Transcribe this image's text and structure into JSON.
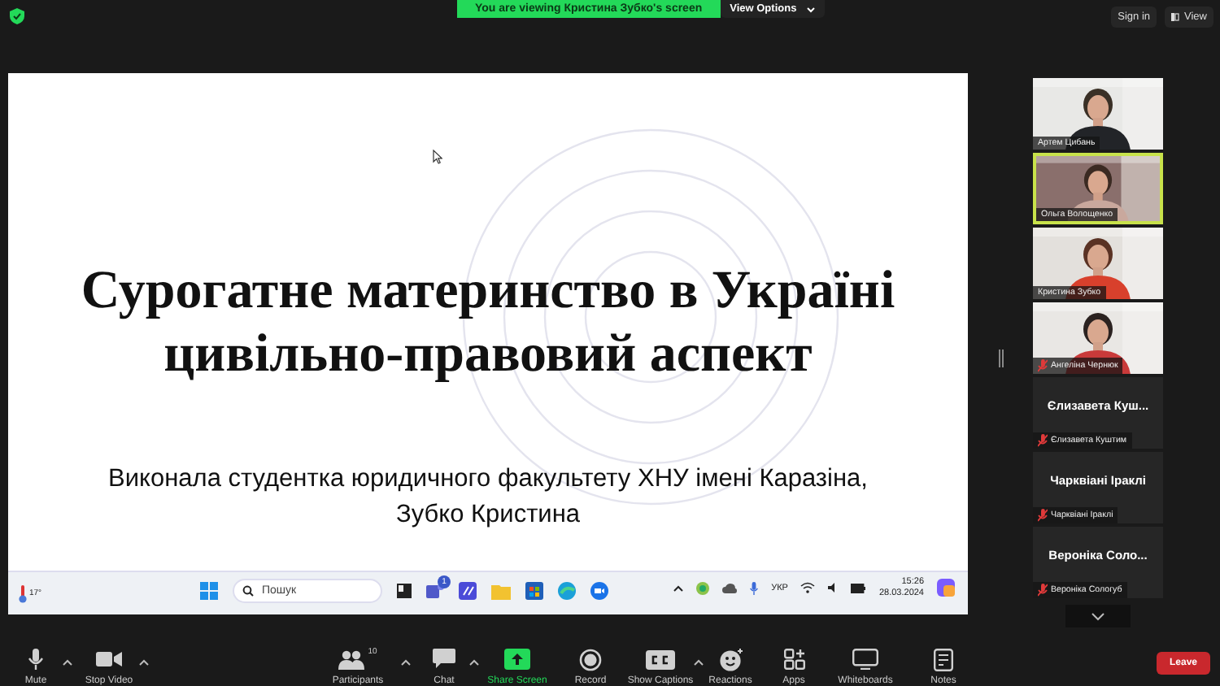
{
  "top_bar": {
    "viewing_banner": "You are viewing Кристина Зубко's screen",
    "view_options": "View Options",
    "sign_in": "Sign in",
    "view": "View"
  },
  "slide": {
    "title_lines": [
      "Сурогатне материнство в Україні",
      "цивільно-правовий аспект"
    ],
    "subtitle_lines": [
      "Виконала студентка юридичного факультету  ХНУ імені Каразіна,",
      "Зубко Кристина"
    ]
  },
  "taskbar": {
    "weather": "17°",
    "search_placeholder": "Пошук",
    "teams_badge": "1",
    "language": "УКР",
    "time": "15:26",
    "date": "28.03.2024"
  },
  "participants": [
    {
      "kind": "video",
      "name": "Артем Цибань",
      "muted": false,
      "speaking": false
    },
    {
      "kind": "video",
      "name": "Ольга Волощенко",
      "muted": false,
      "speaking": true
    },
    {
      "kind": "video",
      "name": "Кристина Зубко",
      "muted": false,
      "speaking": false
    },
    {
      "kind": "video",
      "name": "Ангеліна Чернюк",
      "muted": true,
      "speaking": false
    },
    {
      "kind": "avatar",
      "display": "Єлизавета  Куш...",
      "name": "Єлизавета Куштим",
      "muted": true,
      "speaking": false
    },
    {
      "kind": "avatar",
      "display": "Чарквіані Іраклі",
      "name": "Чарквіані Іраклі",
      "muted": true,
      "speaking": false
    },
    {
      "kind": "avatar",
      "display": "Вероніка Соло...",
      "name": "Вероніка Сологуб",
      "muted": true,
      "speaking": false
    }
  ],
  "toolbar": [
    {
      "label": "Mute",
      "caret": true,
      "highlighted": false
    },
    {
      "label": "Stop Video",
      "caret": true,
      "highlighted": false
    },
    {
      "label": "Participants",
      "count": "10",
      "caret": true,
      "highlighted": false
    },
    {
      "label": "Chat",
      "caret": true,
      "highlighted": false
    },
    {
      "label": "Share Screen",
      "caret": false,
      "highlighted": true
    },
    {
      "label": "Record",
      "caret": false,
      "highlighted": false
    },
    {
      "label": "Show Captions",
      "caret": true,
      "highlighted": false
    },
    {
      "label": "Reactions",
      "caret": false,
      "highlighted": false
    },
    {
      "label": "Apps",
      "caret": false,
      "highlighted": false
    },
    {
      "label": "Whiteboards",
      "caret": false,
      "highlighted": false
    },
    {
      "label": "Notes",
      "caret": false,
      "highlighted": false
    }
  ],
  "leave_button": "Leave"
}
